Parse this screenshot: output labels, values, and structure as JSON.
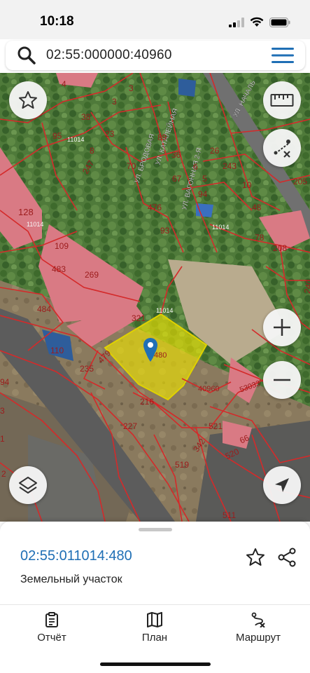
{
  "status_bar": {
    "time": "10:18"
  },
  "search": {
    "value": "02:55:000000:40960",
    "placeholder": ""
  },
  "map": {
    "street_labels": [
      "УЛ. БРОДОВАЯ",
      "УЛ. ВАГОННАЯ 2-Я",
      "УЛ. НАЧАЛЬ",
      "УЛ. КАТАЛЕЙНАЯ"
    ],
    "quarter_labels": [
      "11014",
      "11014",
      "11014",
      "11014"
    ],
    "parcel_labels": [
      "4",
      "128",
      "3",
      "3",
      "38",
      "95",
      "23",
      "8",
      "247",
      "70",
      "89",
      "36",
      "26",
      "243",
      "6",
      "5",
      "67",
      "94",
      "10",
      "205",
      "476",
      "93",
      "109",
      "483",
      "269",
      "48",
      "208",
      "78",
      "484",
      "321",
      "240",
      "110",
      "479",
      "480",
      "235",
      "216",
      "40960",
      "53033",
      "227",
      "521",
      "66",
      "342",
      "520",
      "519",
      "511",
      "94",
      "3",
      "1",
      "2"
    ],
    "selected_parcel": "480",
    "selected_color": "#f2e600",
    "boundary_color": "#d42a2a"
  },
  "controls": {
    "favorite": "star-icon",
    "ruler": "ruler-icon",
    "route": "route-icon",
    "zoom_in": "+",
    "zoom_out": "−",
    "layers": "layers-icon",
    "locate": "locate-icon"
  },
  "bottom_sheet": {
    "cadastral_number": "02:55:011014:480",
    "object_type": "Земельный участок"
  },
  "tabs": [
    {
      "label": "Отчёт",
      "icon": "report-icon"
    },
    {
      "label": "План",
      "icon": "map-icon"
    },
    {
      "label": "Маршрут",
      "icon": "route-icon"
    }
  ],
  "accent_color": "#1f6fb5"
}
